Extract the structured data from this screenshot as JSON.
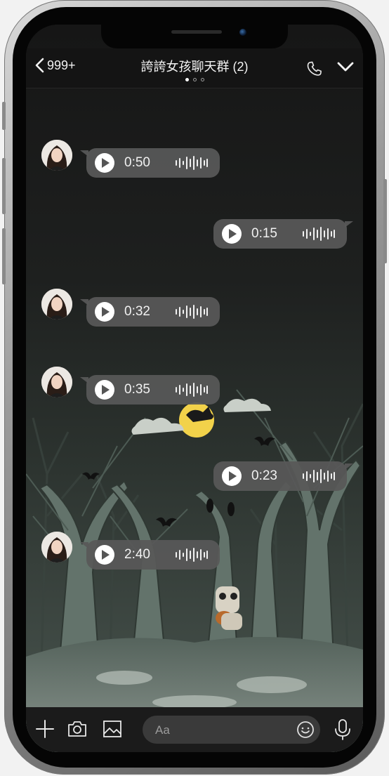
{
  "header": {
    "back_count": "999+",
    "title": "誇誇女孩聊天群 (2)",
    "page_dots": 3,
    "active_dot": 0
  },
  "messages": [
    {
      "direction": "in",
      "type": "voice",
      "duration": "0:50"
    },
    {
      "direction": "out",
      "type": "voice",
      "duration": "0:15"
    },
    {
      "direction": "in",
      "type": "voice",
      "duration": "0:32"
    },
    {
      "direction": "in",
      "type": "voice",
      "duration": "0:35"
    },
    {
      "direction": "out",
      "type": "voice",
      "duration": "0:23"
    },
    {
      "direction": "in",
      "type": "voice",
      "duration": "2:40"
    }
  ],
  "input": {
    "placeholder": "Aa"
  },
  "icons": [
    "chevron-left-icon",
    "phone-icon",
    "chevron-down-icon",
    "plus-icon",
    "camera-icon",
    "image-icon",
    "emoji-icon",
    "microphone-icon",
    "play-icon",
    "waveform-icon"
  ],
  "colors": {
    "header_bg": "#141414",
    "bubble_bg": "#585858",
    "text": "#f1f1f1",
    "bottom_bar_bg": "#1b1b1b"
  }
}
